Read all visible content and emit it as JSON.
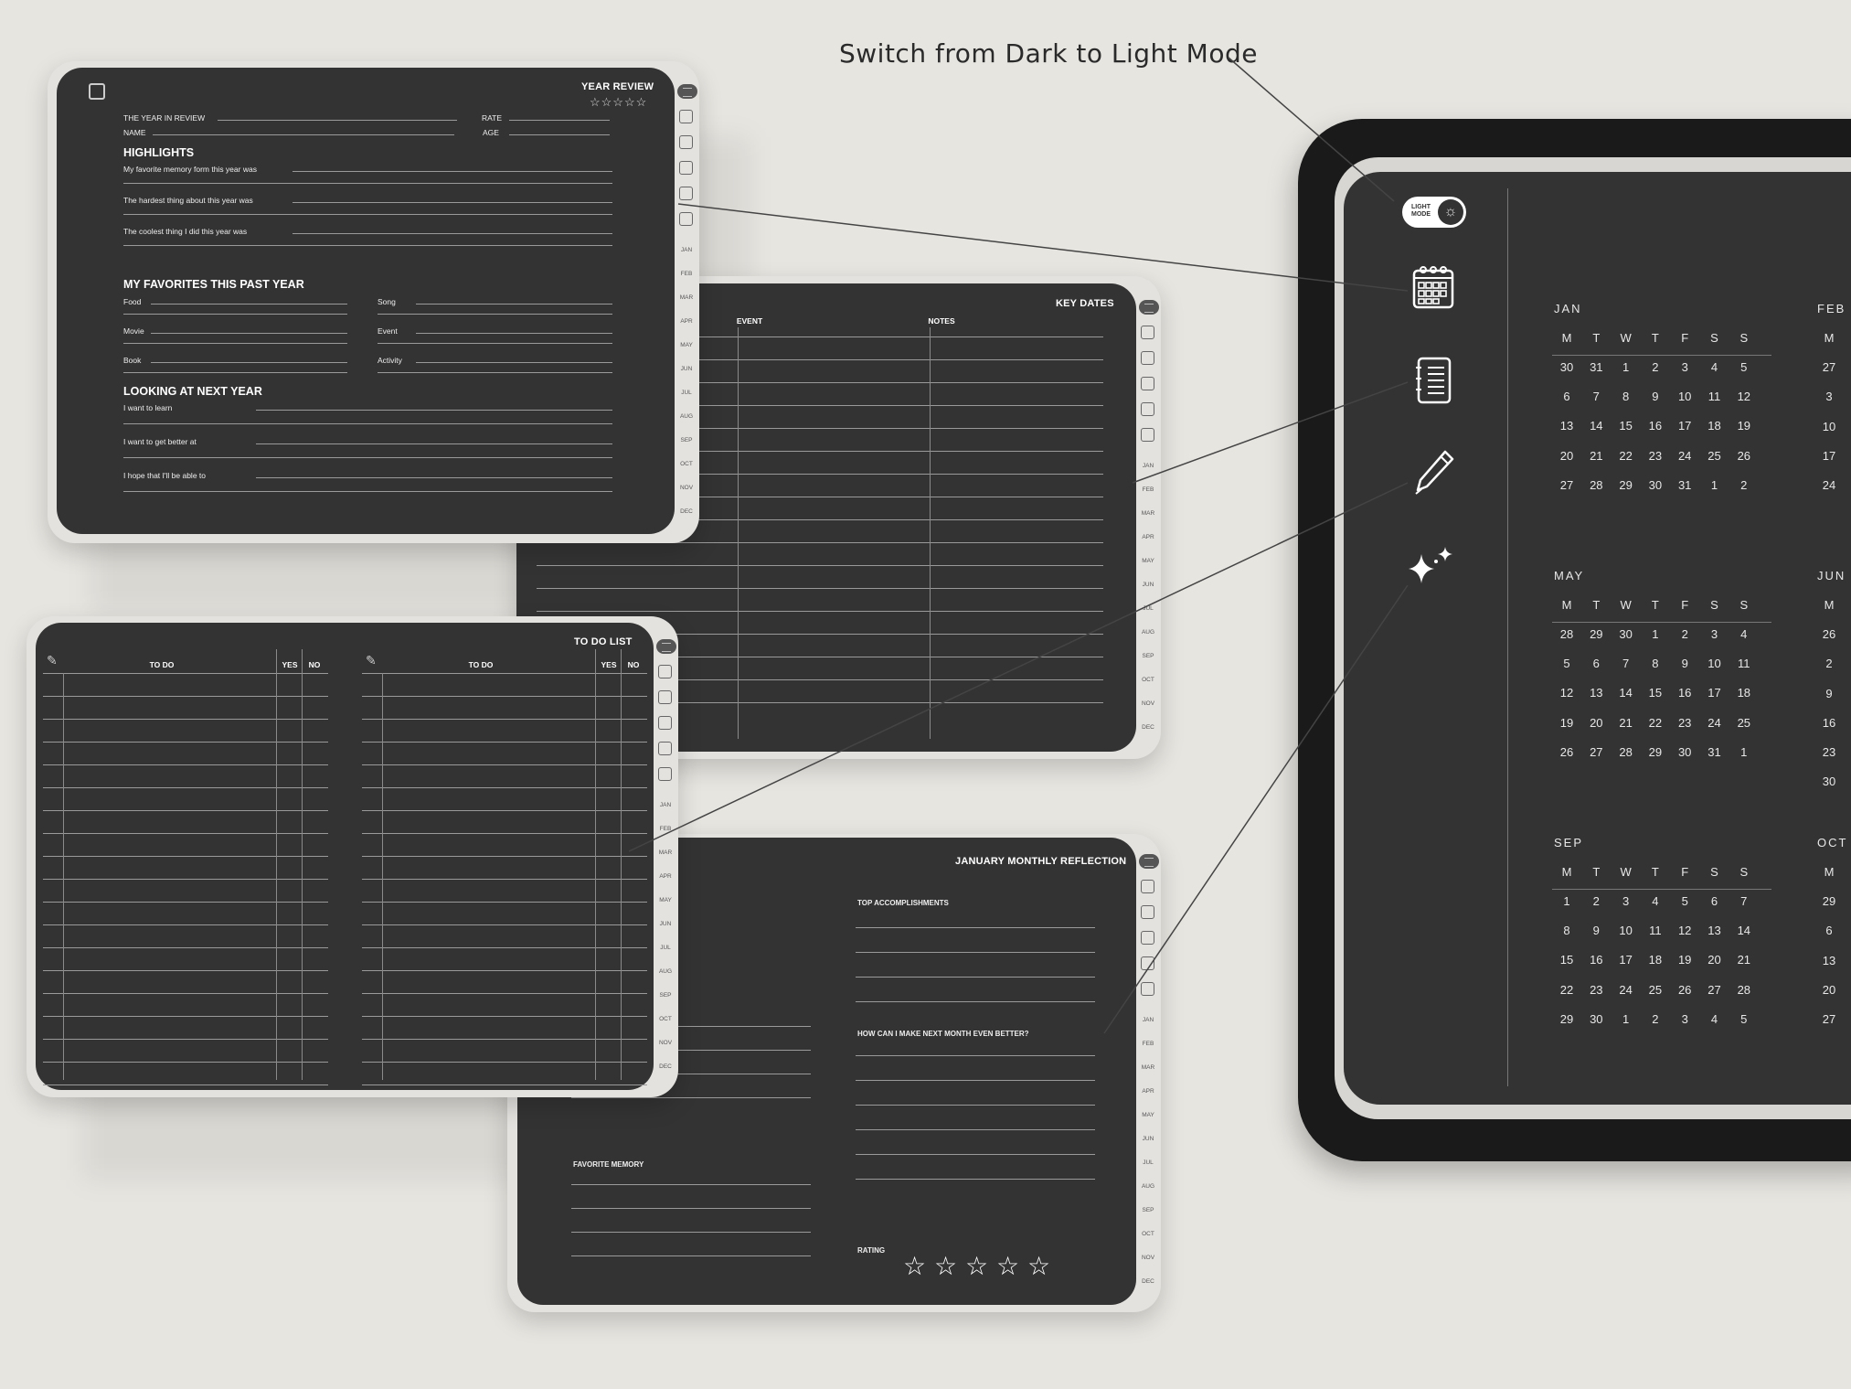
{
  "caption": "Switch from Dark to Light Mode",
  "months_tabs": [
    "JAN",
    "FEB",
    "MAR",
    "APR",
    "MAY",
    "JUN",
    "JUL",
    "AUG",
    "SEP",
    "OCT",
    "NOV",
    "DEC"
  ],
  "year_review": {
    "title": "YEAR REVIEW",
    "stars": "☆☆☆☆☆",
    "fields": {
      "year": "THE YEAR IN REVIEW",
      "rate": "RATE",
      "name": "NAME",
      "age": "AGE"
    },
    "highlights_heading": "HIGHLIGHTS",
    "highlights": [
      "My favorite memory form this year was",
      "The hardest thing about this year was",
      "The coolest thing I did this year was"
    ],
    "favorites_heading": "MY FAVORITES THIS PAST YEAR",
    "favorites_left": [
      "Food",
      "Movie",
      "Book"
    ],
    "favorites_right": [
      "Song",
      "Event",
      "Activity"
    ],
    "next_heading": "LOOKING AT NEXT YEAR",
    "next": [
      "I want to learn",
      "I want to get better at",
      "I hope that I'll be able to"
    ]
  },
  "key_dates": {
    "title": "KEY DATES",
    "col_event": "EVENT",
    "col_notes": "NOTES"
  },
  "todo": {
    "title": "TO DO LIST",
    "col_todo": "TO DO",
    "col_yes": "YES",
    "col_no": "NO"
  },
  "reflection": {
    "title": "JANUARY MONTHLY REFLECTION",
    "top": "TOP ACCOMPLISHMENTS",
    "better": "HOW CAN I MAKE NEXT MONTH EVEN BETTER?",
    "memory": "FAVORITE MEMORY",
    "rating": "RATING",
    "stars": [
      "☆",
      "☆",
      "☆",
      "☆",
      "☆"
    ]
  },
  "tablet": {
    "toggle_label_1": "LIGHT",
    "toggle_label_2": "MODE",
    "toggle_icon": "☼",
    "sidebar_icons": [
      "calendar-icon",
      "notebook-list-icon",
      "pencil-icon",
      "sparkle-icon"
    ],
    "weekdays": [
      "M",
      "T",
      "W",
      "T",
      "F",
      "S",
      "S"
    ],
    "months": [
      {
        "name": "JAN",
        "rows": [
          [
            "30",
            "31",
            "1",
            "2",
            "3",
            "4",
            "5"
          ],
          [
            "6",
            "7",
            "8",
            "9",
            "10",
            "11",
            "12"
          ],
          [
            "13",
            "14",
            "15",
            "16",
            "17",
            "18",
            "19"
          ],
          [
            "20",
            "21",
            "22",
            "23",
            "24",
            "25",
            "26"
          ],
          [
            "27",
            "28",
            "29",
            "30",
            "31",
            "1",
            "2"
          ]
        ]
      },
      {
        "name": "MAY",
        "rows": [
          [
            "28",
            "29",
            "30",
            "1",
            "2",
            "3",
            "4"
          ],
          [
            "5",
            "6",
            "7",
            "8",
            "9",
            "10",
            "11"
          ],
          [
            "12",
            "13",
            "14",
            "15",
            "16",
            "17",
            "18"
          ],
          [
            "19",
            "20",
            "21",
            "22",
            "23",
            "24",
            "25"
          ],
          [
            "26",
            "27",
            "28",
            "29",
            "30",
            "31",
            "1"
          ]
        ]
      },
      {
        "name": "SEP",
        "rows": [
          [
            "1",
            "2",
            "3",
            "4",
            "5",
            "6",
            "7"
          ],
          [
            "8",
            "9",
            "10",
            "11",
            "12",
            "13",
            "14"
          ],
          [
            "15",
            "16",
            "17",
            "18",
            "19",
            "20",
            "21"
          ],
          [
            "22",
            "23",
            "24",
            "25",
            "26",
            "27",
            "28"
          ],
          [
            "29",
            "30",
            "1",
            "2",
            "3",
            "4",
            "5"
          ]
        ]
      }
    ],
    "partial_months": [
      {
        "name": "FEB",
        "col": [
          "M",
          "27",
          "3",
          "10",
          "17",
          "24"
        ]
      },
      {
        "name": "JUN",
        "col": [
          "M",
          "26",
          "2",
          "9",
          "16",
          "23",
          "30"
        ]
      },
      {
        "name": "OCT",
        "col": [
          "M",
          "29",
          "6",
          "13",
          "20",
          "27"
        ]
      }
    ]
  }
}
